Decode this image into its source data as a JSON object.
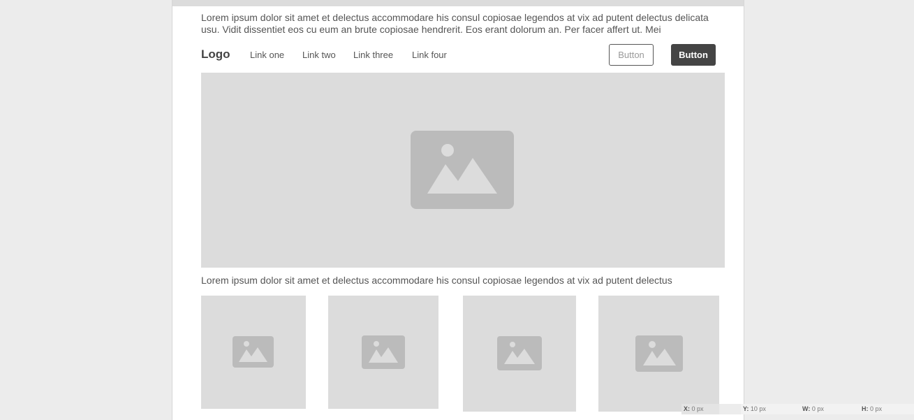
{
  "paragraph_top": "Lorem ipsum dolor sit amet et delectus accommodare his consul copiosae legendos at vix ad putent delectus delicata usu. Vidit dissentiet eos cu eum an brute copiosae hendrerit. Eos erant dolorum an. Per facer affert ut. Mei",
  "navbar": {
    "logo": "Logo",
    "links": [
      "Link one",
      "Link two",
      "Link three",
      "Link four"
    ],
    "button_outline": "Button",
    "button_filled": "Button"
  },
  "hero": {
    "icon": "image-placeholder-icon"
  },
  "paragraph_mid": "Lorem ipsum dolor sit amet et delectus accommodare his consul copiosae legendos at vix ad putent delectus",
  "thumbnails": [
    {
      "icon": "image-placeholder-icon"
    },
    {
      "icon": "image-placeholder-icon"
    },
    {
      "icon": "image-placeholder-icon"
    },
    {
      "icon": "image-placeholder-icon"
    }
  ],
  "statusbar": {
    "x_label": "X:",
    "x_value": "0 px",
    "y_label": "Y:",
    "y_value": "10 px",
    "w_label": "W:",
    "w_value": "0 px",
    "h_label": "H:",
    "h_value": "0 px"
  },
  "colors": {
    "background": "#ececec",
    "canvas": "#ffffff",
    "placeholder": "#dcdcdc",
    "placeholder_icon": "#bbbbbb",
    "text": "#555555",
    "button_dark": "#444444"
  }
}
